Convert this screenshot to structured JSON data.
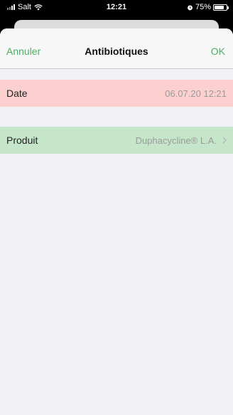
{
  "status_bar": {
    "carrier": "Salt",
    "time": "12:21",
    "battery": "75%"
  },
  "navbar": {
    "cancel_label": "Annuler",
    "title": "Antibiotiques",
    "ok_label": "OK"
  },
  "rows": [
    {
      "label": "Date",
      "value": "06.07.20 12:21"
    },
    {
      "label": "Produit",
      "value": "Duphacycline® L.A."
    }
  ],
  "colors": {
    "accent": "#4caf64",
    "date_row_bg": "#fdd0d0",
    "product_row_bg": "#c6e6c9"
  }
}
